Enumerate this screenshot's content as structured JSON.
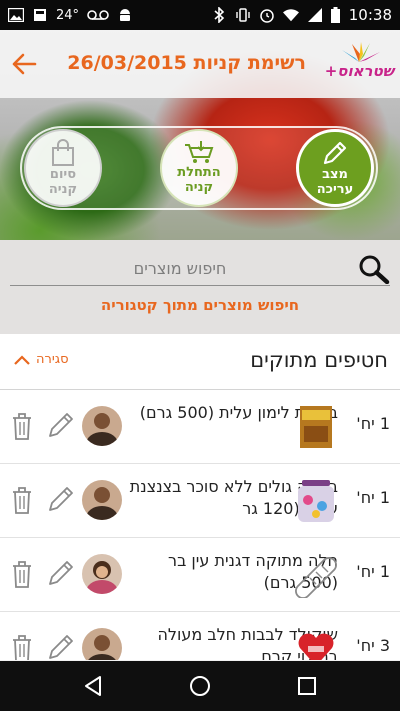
{
  "status_bar": {
    "temperature": "24°",
    "time": "10:38",
    "icons": [
      "image-icon",
      "weather-icon",
      "voicemail-icon",
      "android-icon",
      "bluetooth-icon",
      "vibrate-icon",
      "alarm-icon",
      "wifi-icon",
      "signal-icon",
      "battery-icon"
    ]
  },
  "header": {
    "title": "רשימת קניות 26/03/2015",
    "logo_text": "שטראוס+",
    "back_icon": "arrow-left-icon"
  },
  "actions": [
    {
      "id": "finish",
      "label_line1": "סיום",
      "label_line2": "קניה",
      "icon": "shopping-bag-icon"
    },
    {
      "id": "start",
      "label_line1": "התחלת",
      "label_line2": "קניה",
      "icon": "cart-add-icon"
    },
    {
      "id": "edit",
      "label_line1": "מצב",
      "label_line2": "עריכה",
      "icon": "pencil-icon"
    }
  ],
  "search": {
    "placeholder": "חיפוש מוצרים",
    "category_link": "חיפוש מוצרים מתוך קטגוריה"
  },
  "section": {
    "title": "חטיפים מתוקים",
    "collapse_label": "סגירה"
  },
  "items": [
    {
      "qty": "1 יח'",
      "name": "בפלות לימון עלית (500 גרם)"
    },
    {
      "qty": "1 יח'",
      "name": "בזוקה גולים ללא סוכר בצנצנת עלית (120 גר"
    },
    {
      "qty": "1 יח'",
      "name": "חלה מתוקה דגנית עין בר (500 גרם)"
    },
    {
      "qty": "3 יח'",
      "name": "שוקולד לבבות חלב מעולה במילוי קרם"
    }
  ],
  "colors": {
    "accent": "#e8671f",
    "green": "#6d9f1f",
    "logo_pink": "#c8248a"
  }
}
